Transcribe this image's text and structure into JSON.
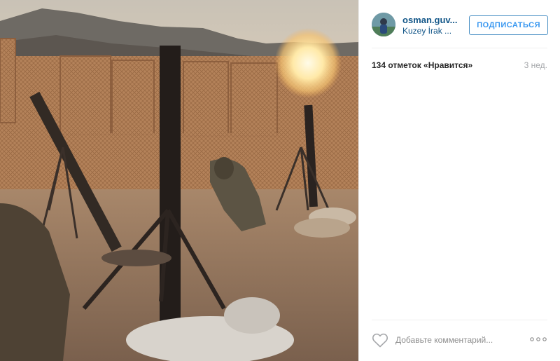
{
  "post": {
    "photo": {
      "alt": ""
    },
    "header": {
      "username": "osman.guv...",
      "location": "Kuzey İrak ...",
      "follow_label": "ПОДПИСАТЬСЯ",
      "avatar_icon": "user-avatar"
    },
    "meta": {
      "likes_text": "134 отметок «Нравится»",
      "time_text": "3 нед."
    },
    "footer": {
      "like_icon": "heart-outline-icon",
      "comment_placeholder": "Добавьте комментарий...",
      "more_icon": "ellipsis-icon"
    },
    "colors": {
      "link": "#125688",
      "button_text": "#3897f0",
      "button_border": "#4a90c4",
      "muted": "#a5a7aa",
      "divider": "#efefef"
    }
  }
}
